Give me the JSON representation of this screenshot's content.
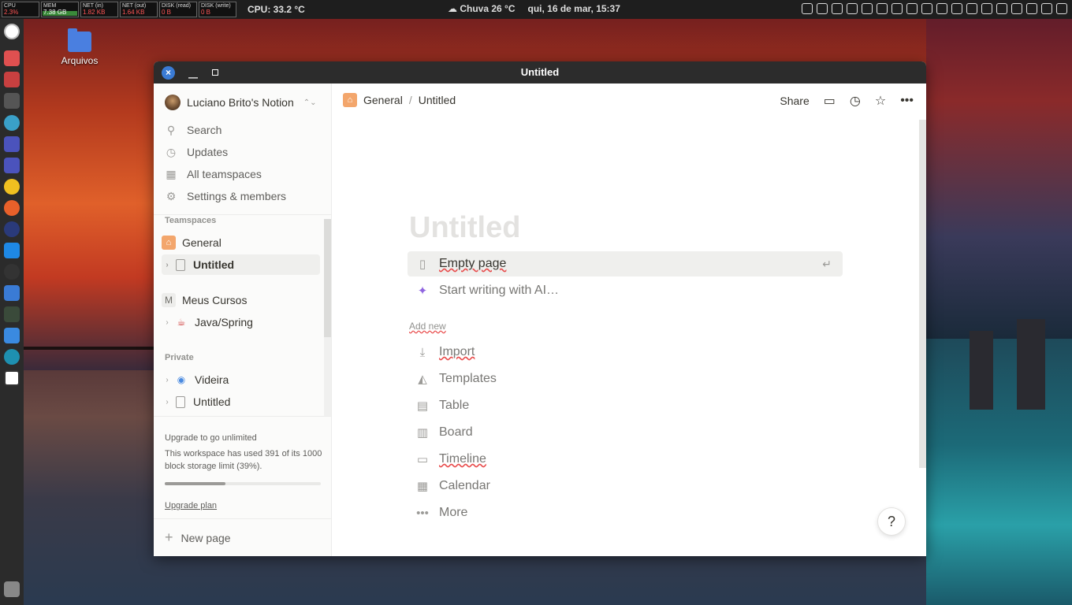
{
  "topbar": {
    "monitors": [
      {
        "label": "CPU",
        "value": "2.3%"
      },
      {
        "label": "MEM",
        "value": "7.38 GB"
      },
      {
        "label": "NET (in)",
        "value": "1.82 KB"
      },
      {
        "label": "NET (out)",
        "value": "1.64 KB"
      },
      {
        "label": "DISK (read)",
        "value": "0 B"
      },
      {
        "label": "DISK (write)",
        "value": "0 B"
      }
    ],
    "cpu_temp": "CPU: 33.2 °C",
    "weather": "Chuva 26 °C",
    "datetime": "qui, 16 de mar, 15:37"
  },
  "desktop": {
    "folder_label": "Arquivos"
  },
  "window": {
    "title": "Untitled"
  },
  "sidebar": {
    "workspace": "Luciano Brito's Notion",
    "nav": [
      {
        "label": "Search",
        "icon": "search-icon"
      },
      {
        "label": "Updates",
        "icon": "clock-icon"
      },
      {
        "label": "All teamspaces",
        "icon": "building-icon"
      },
      {
        "label": "Settings & members",
        "icon": "gear-icon"
      }
    ],
    "teamspaces_header": "Teamspaces",
    "general": "General",
    "untitled_active": "Untitled",
    "meus_cursos": "Meus Cursos",
    "java_spring": "Java/Spring",
    "private_header": "Private",
    "videira": "Videira",
    "untitled_private": "Untitled",
    "upgrade": {
      "title": "Upgrade to go unlimited",
      "text": "This workspace has used 391 of its 1000 block storage limit (39%).",
      "usage_fraction": 0.39,
      "link": "Upgrade plan"
    },
    "new_page": "New page"
  },
  "main": {
    "breadcrumb": {
      "parent": "General",
      "current": "Untitled"
    },
    "share": "Share",
    "page_title_placeholder": "Untitled",
    "empty_page": "Empty page",
    "ai": "Start writing with AI…",
    "add_new": "Add new",
    "options": [
      {
        "label": "Import",
        "icon": "import-icon"
      },
      {
        "label": "Templates",
        "icon": "templates-icon"
      },
      {
        "label": "Table",
        "icon": "table-icon"
      },
      {
        "label": "Board",
        "icon": "board-icon"
      },
      {
        "label": "Timeline",
        "icon": "timeline-icon"
      },
      {
        "label": "Calendar",
        "icon": "calendar-icon"
      },
      {
        "label": "More",
        "icon": "more-icon"
      }
    ],
    "help": "?"
  }
}
